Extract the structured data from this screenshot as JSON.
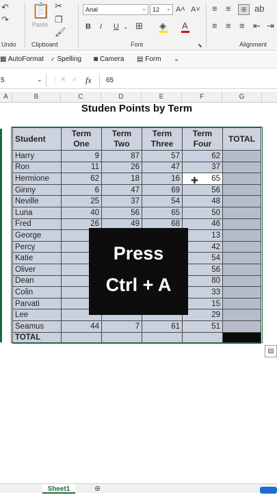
{
  "ribbon": {
    "undo_label": "Undo",
    "clipboard_label": "Clipboard",
    "paste_label": "Paste",
    "font_label": "Font",
    "alignment_label": "Alignment",
    "font_name": "Arial",
    "font_size": "12",
    "bold": "B",
    "italic": "I",
    "underline": "U"
  },
  "quickbar": {
    "autoformat": "AutoFormat",
    "spelling": "Spelling",
    "camera": "Camera",
    "form": "Form"
  },
  "formula_bar": {
    "name_box": "5",
    "fx": "fx",
    "value": "65"
  },
  "columns": [
    "A",
    "B",
    "C",
    "D",
    "E",
    "F",
    "G"
  ],
  "sheet": {
    "title": "Studen Points by Term",
    "headers": [
      "Student",
      "Term One",
      "Term Two",
      "Term Three",
      "Term Four",
      "TOTAL"
    ],
    "rows": [
      {
        "name": "Harry",
        "t1": "9",
        "t2": "87",
        "t3": "57",
        "t4": "62"
      },
      {
        "name": "Ron",
        "t1": "11",
        "t2": "26",
        "t3": "47",
        "t4": "37"
      },
      {
        "name": "Hermione",
        "t1": "62",
        "t2": "18",
        "t3": "16",
        "t4": "65"
      },
      {
        "name": "Ginny",
        "t1": "6",
        "t2": "47",
        "t3": "69",
        "t4": "56"
      },
      {
        "name": "Neville",
        "t1": "25",
        "t2": "37",
        "t3": "54",
        "t4": "48"
      },
      {
        "name": "Luna",
        "t1": "40",
        "t2": "56",
        "t3": "65",
        "t4": "50"
      },
      {
        "name": "Fred",
        "t1": "26",
        "t2": "49",
        "t3": "68",
        "t4": "46"
      },
      {
        "name": "George",
        "t1": "",
        "t2": "",
        "t3": "",
        "t4": "13"
      },
      {
        "name": "Percy",
        "t1": "",
        "t2": "",
        "t3": "",
        "t4": "42"
      },
      {
        "name": "Katie",
        "t1": "",
        "t2": "",
        "t3": "",
        "t4": "54"
      },
      {
        "name": "Oliver",
        "t1": "",
        "t2": "",
        "t3": "",
        "t4": "56"
      },
      {
        "name": "Dean",
        "t1": "",
        "t2": "",
        "t3": "",
        "t4": "80"
      },
      {
        "name": "Colin",
        "t1": "",
        "t2": "",
        "t3": "",
        "t4": "33"
      },
      {
        "name": "Parvati",
        "t1": "",
        "t2": "",
        "t3": "",
        "t4": "15"
      },
      {
        "name": "Lee",
        "t1": "",
        "t2": "",
        "t3": "",
        "t4": "29"
      },
      {
        "name": "Seamus",
        "t1": "44",
        "t2": "7",
        "t3": "61",
        "t4": "51"
      }
    ],
    "total_label": "TOTAL"
  },
  "overlay": {
    "line1": "Press",
    "line2": "Ctrl + A"
  },
  "tabs": {
    "sheet1": "Sheet1"
  }
}
